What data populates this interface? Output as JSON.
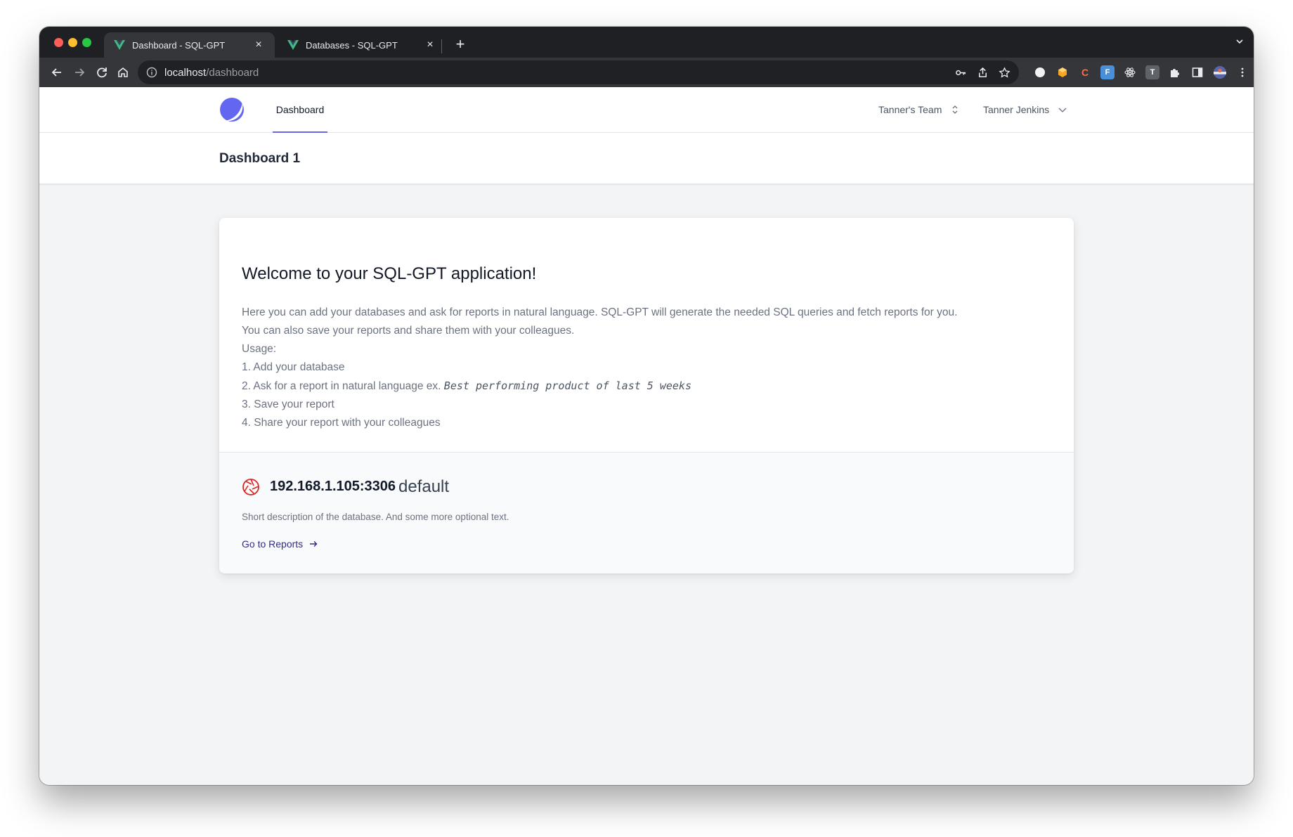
{
  "browser": {
    "tabs": [
      {
        "title": "Dashboard - SQL-GPT",
        "close": "×"
      },
      {
        "title": "Databases - SQL-GPT",
        "close": "×"
      }
    ],
    "new_tab": "+",
    "url_host": "localhost",
    "url_path": "/dashboard",
    "extensions": [
      "C",
      "F",
      "T"
    ]
  },
  "nav": {
    "dashboard_link": "Dashboard",
    "team": "Tanner's Team",
    "user": "Tanner Jenkins"
  },
  "page": {
    "title": "Dashboard 1"
  },
  "welcome": {
    "heading": "Welcome to your SQL-GPT application!",
    "line1": "Here you can add your databases and ask for reports in natural language. SQL-GPT will generate the needed SQL queries and fetch reports for you.",
    "line2": "You can also save your reports and share them with your colleagues.",
    "usage_label": "Usage:",
    "step1": "1. Add your database",
    "step2_prefix": "2. Ask for a report in natural language ex.",
    "step2_example": "Best performing product of last 5 weeks",
    "step3": "3. Save your report",
    "step4": "4. Share your report with your colleagues"
  },
  "database": {
    "host": "192.168.1.105:3306",
    "name": "default",
    "description": "Short description of the database. And some more optional text.",
    "link_label": "Go to Reports"
  },
  "colors": {
    "accent": "#6366f1",
    "db_icon": "#dc2626",
    "link": "#312e81"
  }
}
